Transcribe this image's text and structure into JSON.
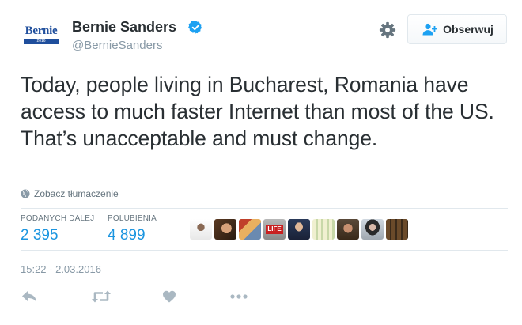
{
  "user": {
    "name": "Bernie Sanders",
    "handle": "@BernieSanders",
    "avatar_text": "Bernie",
    "avatar_subtext": "2016",
    "verified": true
  },
  "follow_button": {
    "label": "Obserwuj",
    "icon": "add-user-icon"
  },
  "tweet": {
    "text": "Today, people living in Bucharest, Romania have access to much faster Internet than most of the US. That’s unacceptable and must change."
  },
  "translate": {
    "label": "Zobacz tłumaczenie",
    "icon": "globe-icon"
  },
  "stats": {
    "retweets_label": "PODANYCH DALEJ",
    "retweets_value": "2 395",
    "likes_label": "POLUBIENIA",
    "likes_value": "4 899"
  },
  "liker_avatars": 9,
  "timestamp": "15:22 - 2.03.2016",
  "actions": [
    "reply-icon",
    "retweet-icon",
    "like-icon",
    "more-icon"
  ],
  "colors": {
    "text": "#292f33",
    "muted": "#8899a6",
    "link_blue": "#1b95e0",
    "verified_blue": "#1da1f2",
    "action_gray": "#aab8c2"
  }
}
